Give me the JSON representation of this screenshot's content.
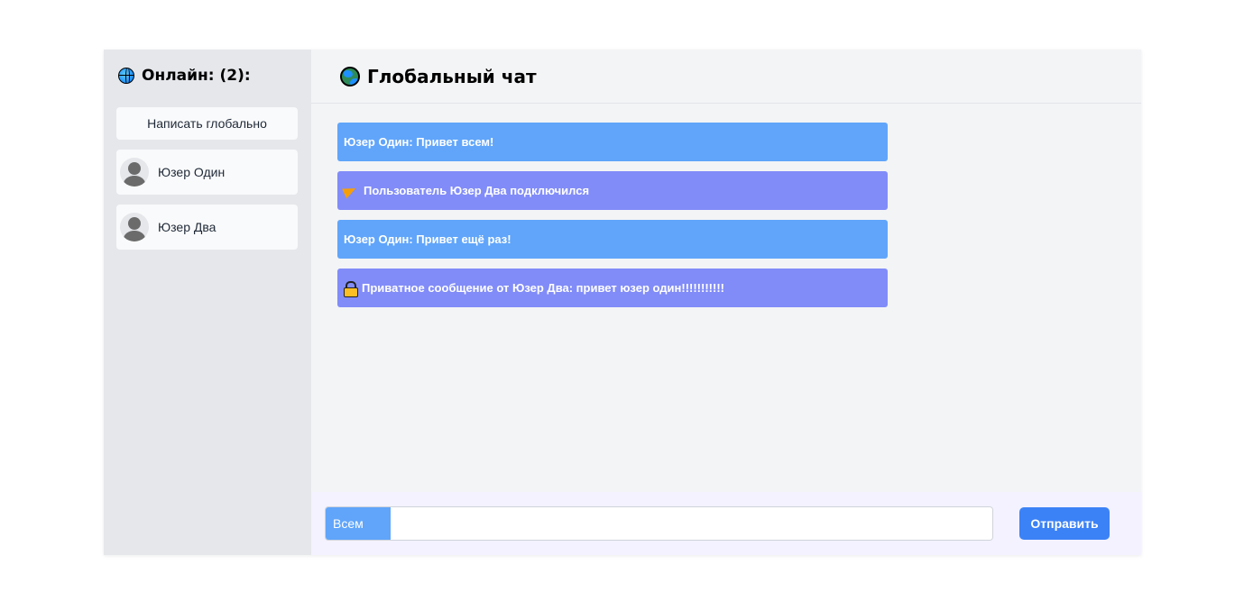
{
  "sidebar": {
    "title": "Онлайн: (2):",
    "title_icon": "globe-icon",
    "global_button_label": "Написать глобально",
    "users": [
      {
        "name": "Юзер Один",
        "icon": "user-avatar-icon"
      },
      {
        "name": "Юзер Два",
        "icon": "user-avatar-icon"
      }
    ]
  },
  "header": {
    "title": "Глобальный чат",
    "title_icon": "globe-earth-icon"
  },
  "messages": [
    {
      "text": "Юзер Один: Привет всем!",
      "type": "chat",
      "color": "#60a5fa"
    },
    {
      "text": "Пользователь Юзер Два подключился",
      "type": "system",
      "icon": "party-horn-icon",
      "color": "#818cf8"
    },
    {
      "text": "Юзер Один: Привет ещё раз!",
      "type": "chat",
      "color": "#60a5fa"
    },
    {
      "text": "Приватное сообщение от Юзер Два: привет юзер один!!!!!!!!!!!",
      "type": "private",
      "icon": "lock-icon",
      "color": "#818cf8"
    }
  ],
  "composer": {
    "recipient": "Всем",
    "input_value": "",
    "send_label": "Отправить"
  },
  "colors": {
    "sidebar_bg": "#e5e7eb",
    "main_bg": "#f3f4f6",
    "chat_message": "#60a5fa",
    "system_message": "#818cf8",
    "send_button": "#3b82f6"
  }
}
